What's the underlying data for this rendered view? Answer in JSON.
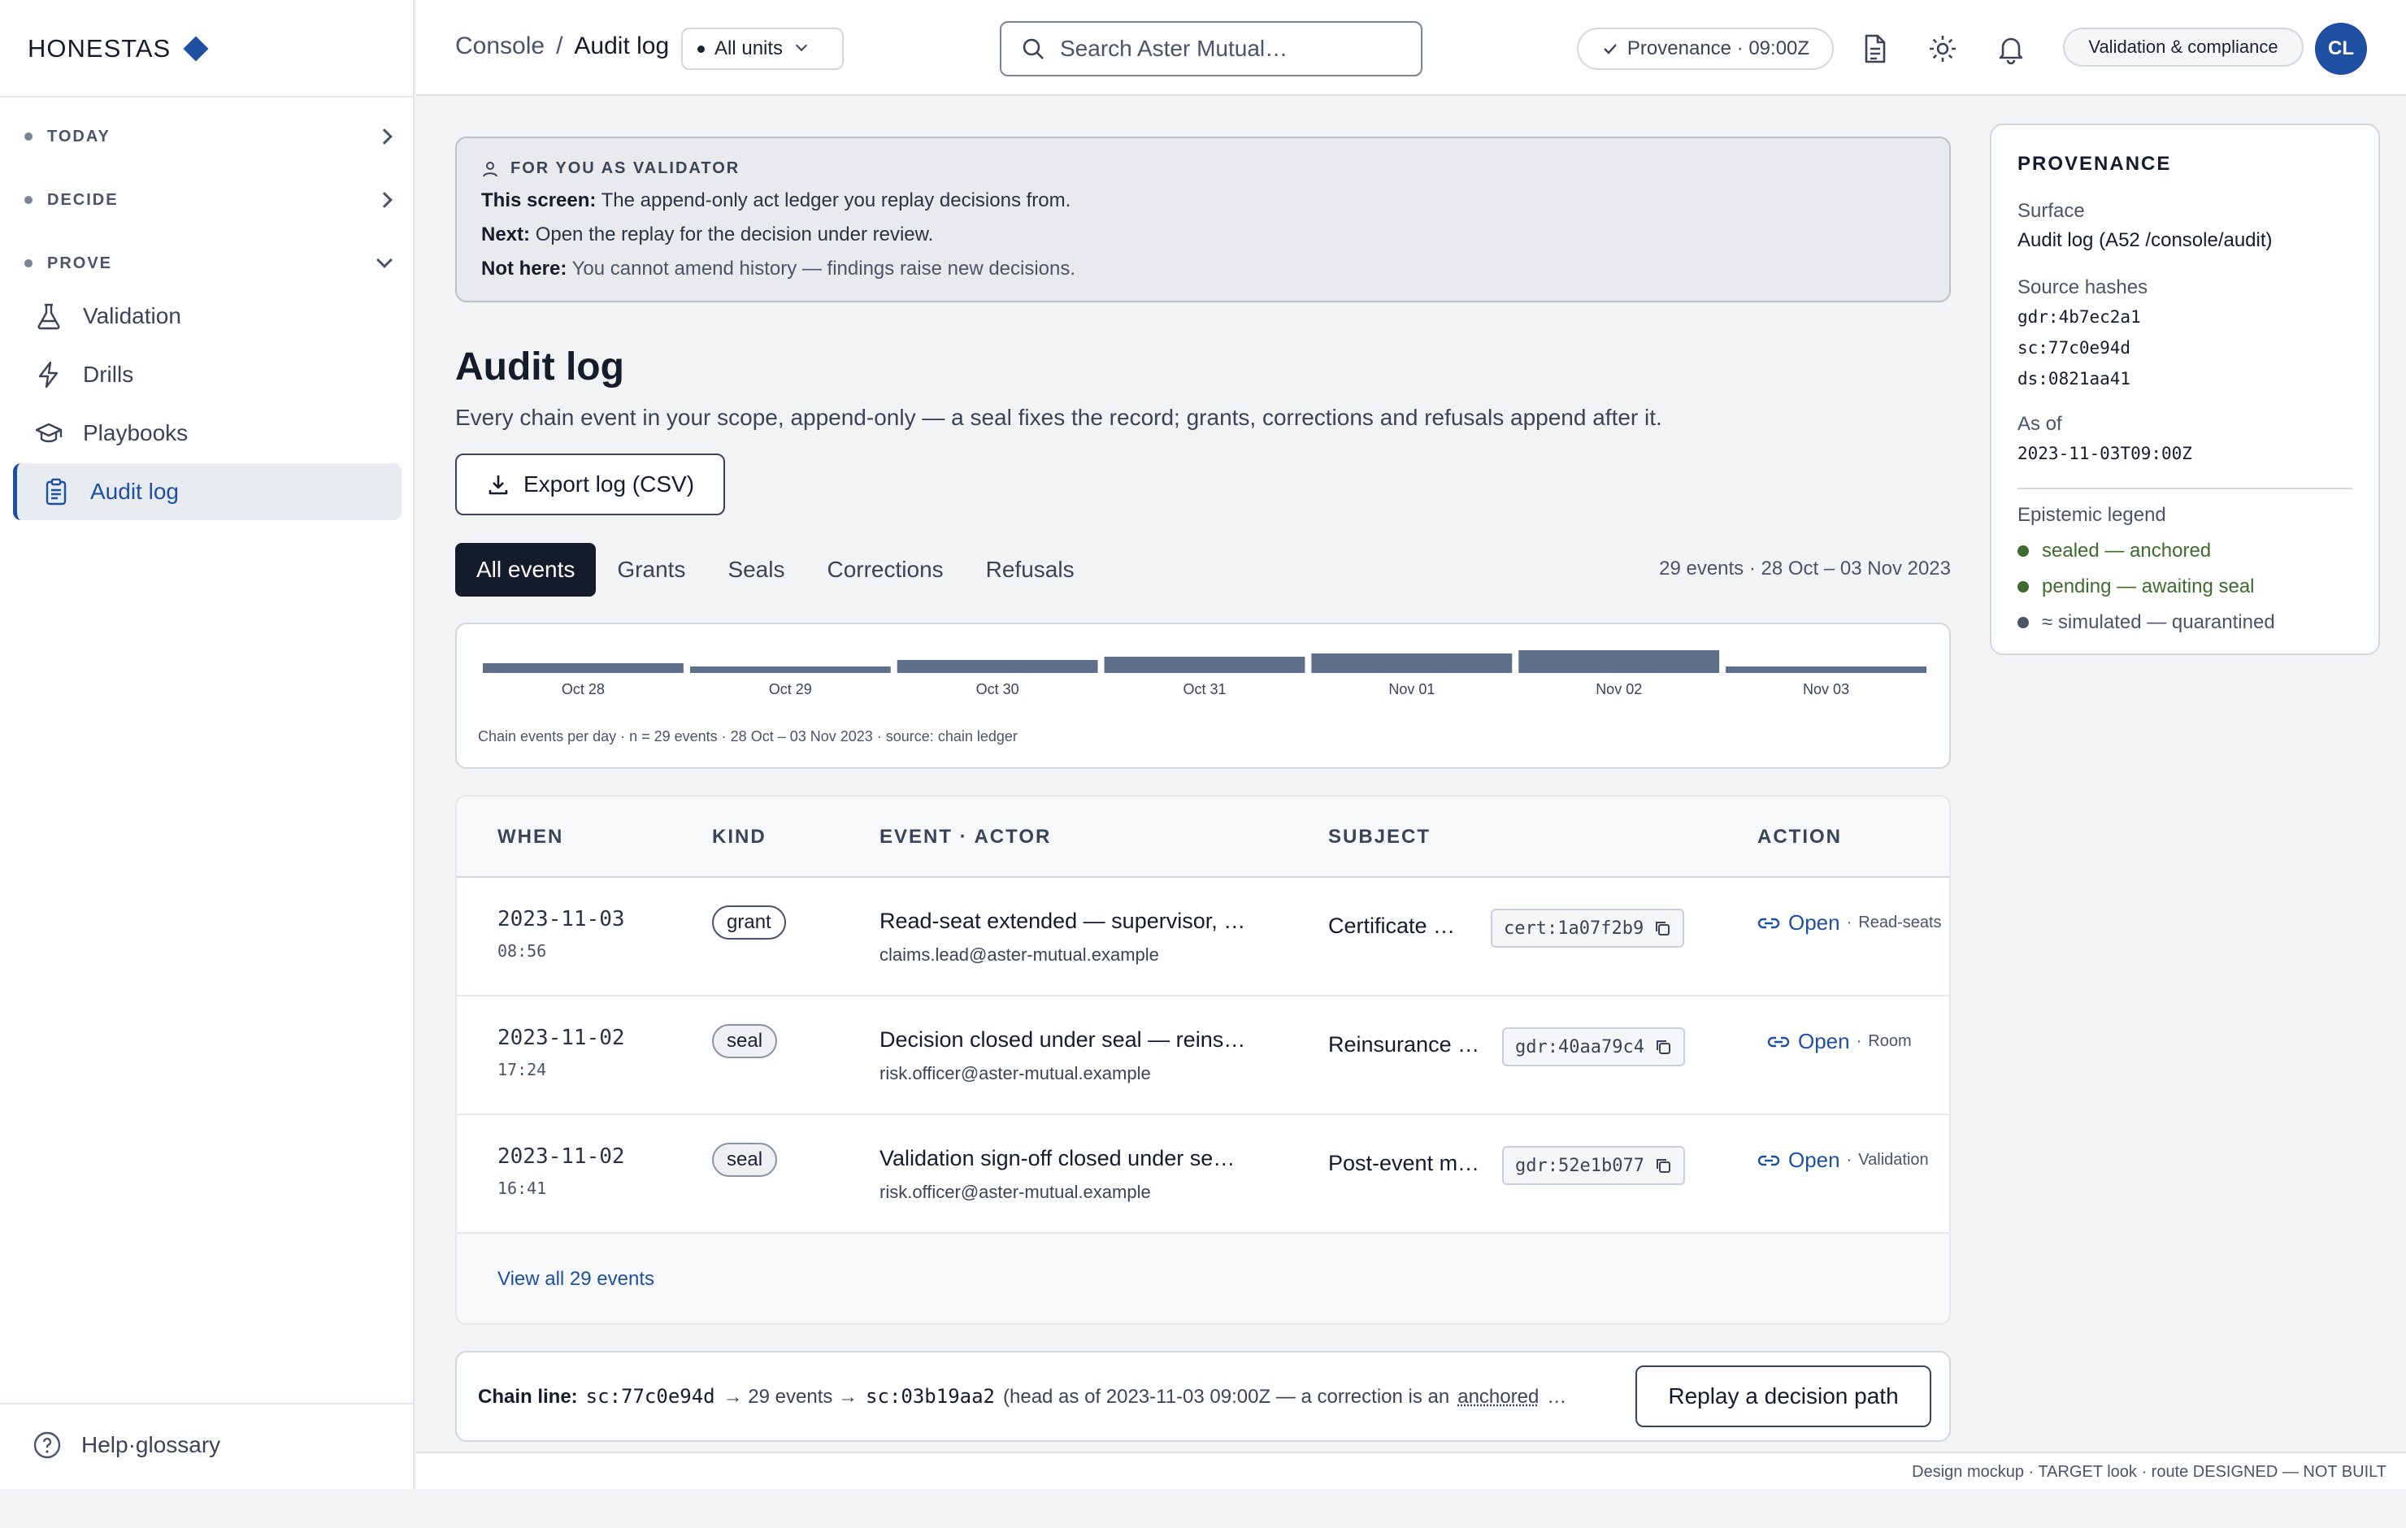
{
  "brand": {
    "name": "HONESTAS"
  },
  "sidebar": {
    "groups": [
      {
        "label": "TODAY"
      },
      {
        "label": "DECIDE"
      },
      {
        "label": "PROVE"
      }
    ],
    "items": [
      {
        "label": "Validation",
        "icon": "flask-icon"
      },
      {
        "label": "Drills",
        "icon": "bolt-icon"
      },
      {
        "label": "Playbooks",
        "icon": "mortarboard-icon"
      },
      {
        "label": "Audit log",
        "icon": "clipboard-icon",
        "active": true
      }
    ],
    "help_label": "Help·glossary"
  },
  "topbar": {
    "breadcrumb_root": "Console",
    "breadcrumb_sep": "/",
    "breadcrumb_current": "Audit log",
    "units_label": "All units",
    "search_placeholder": "Search Aster Mutual…",
    "provenance_chip": "Provenance · 09:00Z",
    "role_chip": "Validation & compliance",
    "avatar_initials": "CL"
  },
  "hint": {
    "title": "FOR YOU AS VALIDATOR",
    "line1_label": "This screen:",
    "line1_text": "The append-only act ledger you replay decisions from.",
    "line2_label": "Next:",
    "line2_text": "Open the replay for the decision under review.",
    "line3_label": "Not here:",
    "line3_text": "You cannot amend history — findings raise new decisions."
  },
  "page": {
    "title": "Audit log",
    "subtitle": "Every chain event in your scope, append-only — a seal fixes the record; grants, corrections and refusals append after it.",
    "export_label": "Export log (CSV)"
  },
  "tabs": [
    "All events",
    "Grants",
    "Seals",
    "Corrections",
    "Refusals"
  ],
  "tab_summary": "29 events · 28 Oct – 03 Nov 2023",
  "chart_data": {
    "type": "bar",
    "categories": [
      "Oct 28",
      "Oct 29",
      "Oct 30",
      "Oct 31",
      "Nov 01",
      "Nov 02",
      "Nov 03"
    ],
    "values": [
      3,
      2,
      4,
      5,
      6,
      7,
      2
    ],
    "caption": "Chain events per day · n = 29 events · 28 Oct – 03 Nov 2023 · source: chain ledger",
    "color": "#5f6f88"
  },
  "table": {
    "headers": {
      "when": "WHEN",
      "kind": "KIND",
      "event": "EVENT · ACTOR",
      "subject": "SUBJECT",
      "action": "ACTION"
    },
    "rows": [
      {
        "date": "2023-11-03",
        "time": "08:56",
        "kind": "grant",
        "event": "Read-seat extended — supervisor, …",
        "actor": "claims.lead@aster-mutual.example",
        "subject": "Certificate …",
        "hash": "cert:1a07f2b9",
        "open": "Open",
        "target": "Read-seats"
      },
      {
        "date": "2023-11-02",
        "time": "17:24",
        "kind": "seal",
        "event": "Decision closed under seal — reins…",
        "actor": "risk.officer@aster-mutual.example",
        "subject": "Reinsurance …",
        "hash": "gdr:40aa79c4",
        "open": "Open",
        "target": "Room"
      },
      {
        "date": "2023-11-02",
        "time": "16:41",
        "kind": "seal",
        "event": "Validation sign-off closed under se…",
        "actor": "risk.officer@aster-mutual.example",
        "subject": "Post-event m…",
        "hash": "gdr:52e1b077",
        "open": "Open",
        "target": "Validation"
      }
    ],
    "view_all": "View all 29 events"
  },
  "chain": {
    "label": "Chain line:",
    "from": "sc:77c0e94d",
    "arrow1": "→ 29 events →",
    "to": "sc:03b19aa2",
    "note_start": "(head as of 2023-11-03 09:00Z — a correction is an",
    "note_link": "anchored",
    "note_end": "…",
    "replay_label": "Replay a decision path"
  },
  "provenance": {
    "title": "PROVENANCE",
    "surface_label": "Surface",
    "surface_value": "Audit log (A52 /console/audit)",
    "hashes_label": "Source hashes",
    "hashes": [
      "gdr:4b7ec2a1",
      "sc:77c0e94d",
      "ds:0821aa41"
    ],
    "asof_label": "As of",
    "asof_value": "2023-11-03T09:00Z",
    "legend_label": "Epistemic legend",
    "legend": [
      {
        "text": "sealed — anchored",
        "color": "#3e6b2e"
      },
      {
        "text": "pending — awaiting seal",
        "color": "#3e6b2e"
      },
      {
        "text": "≈ simulated — quarantined",
        "color": "#4a5468"
      }
    ]
  },
  "footer": {
    "text": "Design mockup · TARGET look · route DESIGNED — NOT BUILT"
  }
}
